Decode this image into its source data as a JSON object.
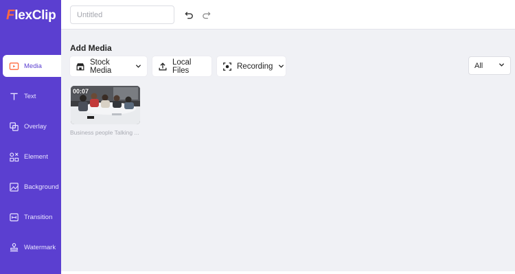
{
  "app": {
    "logo_mark": "F",
    "logo_text": "lexClip"
  },
  "sidebar": {
    "items": [
      {
        "label": "Media",
        "icon": "media-folder-icon",
        "active": true
      },
      {
        "label": "Text",
        "icon": "text-icon",
        "active": false
      },
      {
        "label": "Overlay",
        "icon": "overlay-icon",
        "active": false
      },
      {
        "label": "Element",
        "icon": "element-icon",
        "active": false
      },
      {
        "label": "Background",
        "icon": "background-icon",
        "active": false
      },
      {
        "label": "Transition",
        "icon": "transition-icon",
        "active": false
      },
      {
        "label": "Watermark",
        "icon": "watermark-icon",
        "active": false
      }
    ]
  },
  "topbar": {
    "title_placeholder": "Untitled",
    "title_value": "",
    "undo_icon": "undo-icon",
    "redo_icon": "redo-icon"
  },
  "main": {
    "section_title": "Add Media",
    "stock_media_label": "Stock Media",
    "local_files_label": "Local Files",
    "recording_label": "Recording",
    "filter_value": "All",
    "media_items": [
      {
        "duration": "00:07",
        "caption": "Business people Talking ..."
      }
    ]
  },
  "colors": {
    "sidebar_bg": "#5b3fd0",
    "accent_orange": "#ff6a3d",
    "content_bg": "#f0f1f5"
  }
}
